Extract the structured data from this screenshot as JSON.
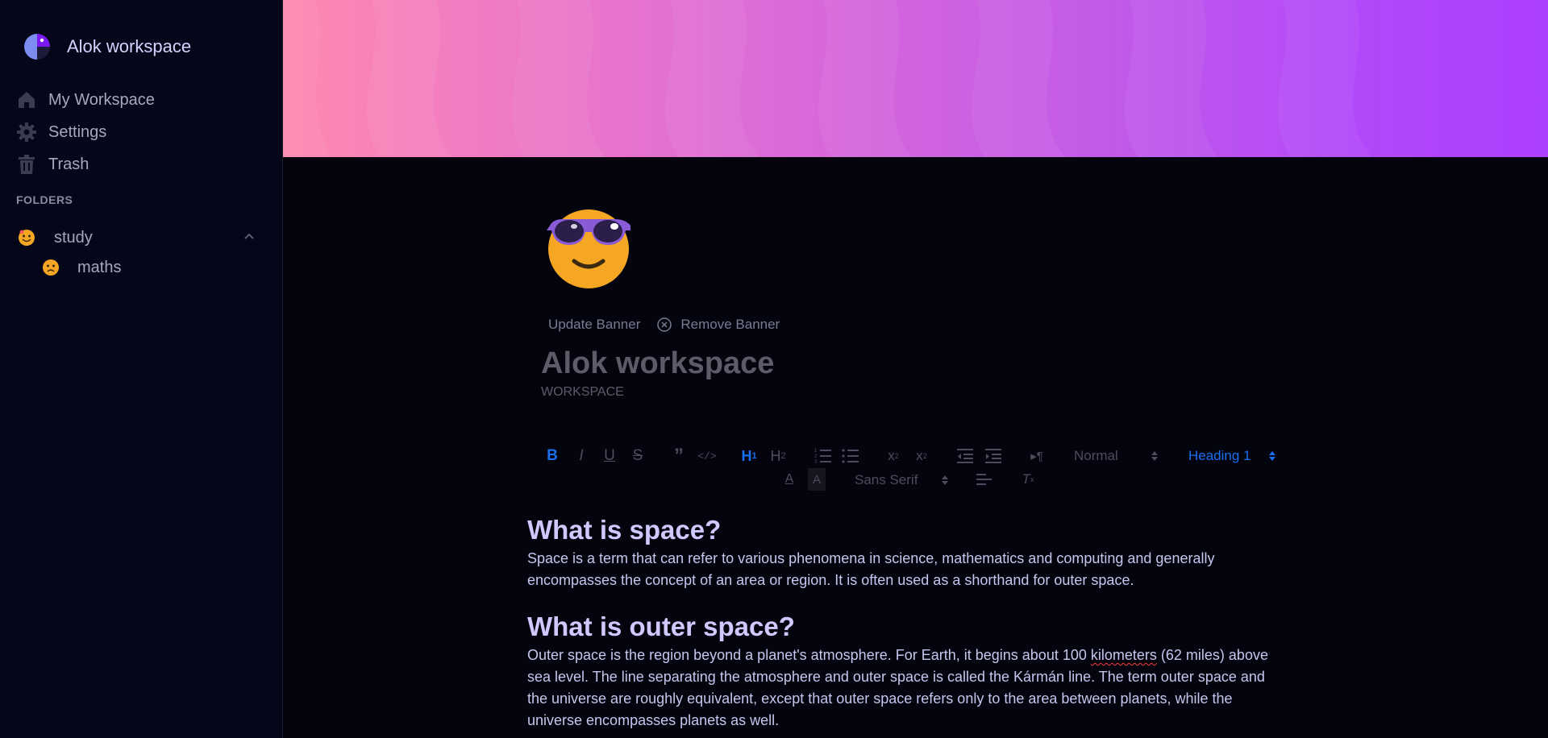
{
  "sidebar": {
    "workspace_name": "Alok workspace",
    "nav": [
      {
        "label": "My Workspace",
        "icon": "home-icon"
      },
      {
        "label": "Settings",
        "icon": "gear-icon"
      },
      {
        "label": "Trash",
        "icon": "trash-icon"
      }
    ],
    "folders_title": "FOLDERS",
    "folder": {
      "label": "study",
      "icon": "smiling-face-emoji",
      "expanded": true
    },
    "files": [
      {
        "label": "maths",
        "icon": "sad-face-emoji"
      }
    ]
  },
  "main": {
    "icon": "smiling-face-with-sunglasses-emoji",
    "update_banner": "Update Banner",
    "remove_banner": "Remove Banner",
    "title": "Alok workspace",
    "subtitle": "WORKSPACE"
  },
  "toolbar": {
    "size_select": "Normal",
    "header_select": "Heading 1",
    "font_select": "Sans Serif",
    "active_color": "#1a6ef0"
  },
  "article": {
    "h1": "What is space?",
    "p1": "Space is a term that can refer to various phenomena in science, mathematics and computing and generally encompasses the concept of an area or region. It is often used as a shorthand for outer space.",
    "h2": "What is outer space?",
    "p2_before": "Outer space is the region beyond a planet's atmosphere. For Earth, it begins about 100 ",
    "p2_misspelled": "kilometers",
    "p2_after": " (62 miles) above sea level. The line separating the atmosphere and outer space is called the Kármán line. The term outer space and the universe are roughly equivalent, except that outer space refers only to the area between planets, while the universe encompasses planets as well."
  }
}
